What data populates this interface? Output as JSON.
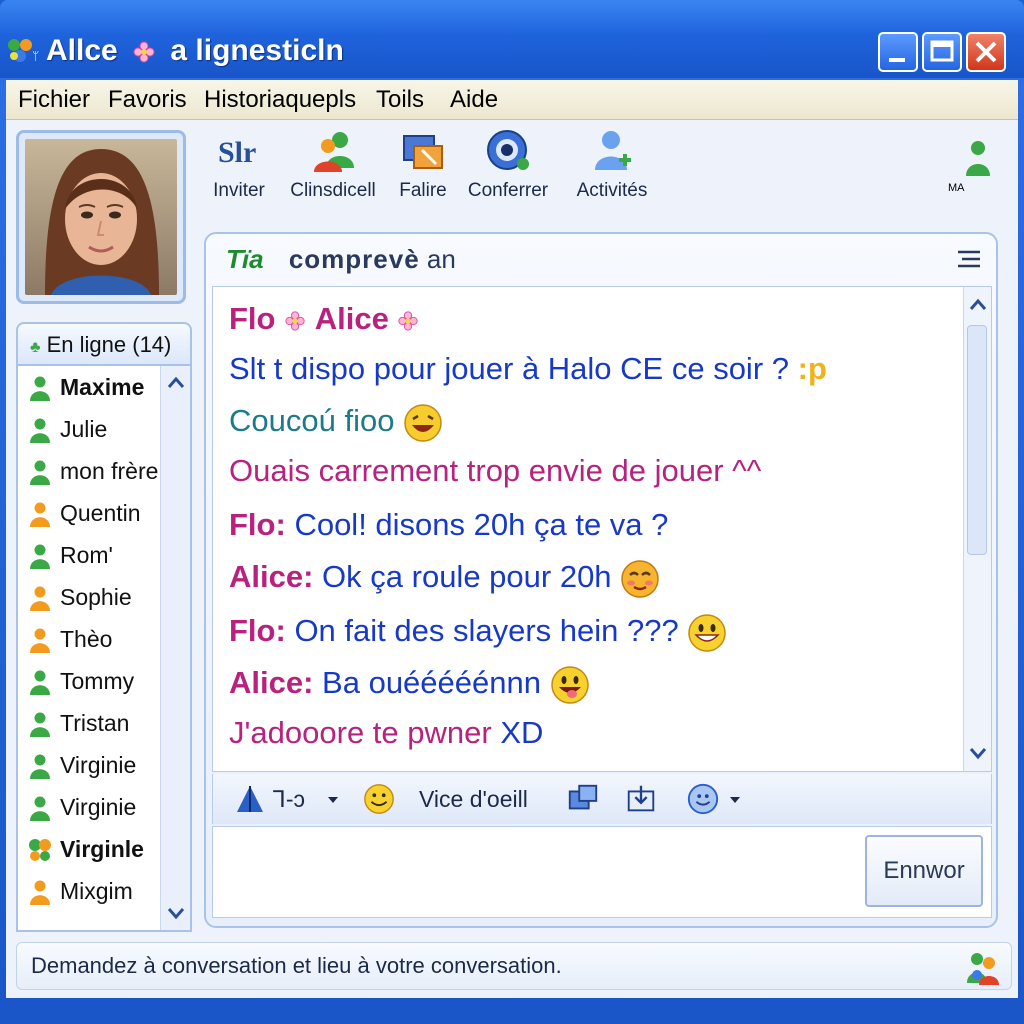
{
  "window": {
    "title": "Allce",
    "title_rest": "a  lignesticln"
  },
  "menu": [
    "Fichier",
    "Favoris",
    "Historiaquepls",
    "Toils",
    "Aide"
  ],
  "toolbar": {
    "items": [
      {
        "label": "Inviter",
        "icon": "invite-text-icon",
        "glyph": "Slr"
      },
      {
        "label": "Clinsdicell",
        "icon": "contacts-icon"
      },
      {
        "label": "Falire",
        "icon": "files-icon"
      },
      {
        "label": "Conferrer",
        "icon": "webcam-icon"
      },
      {
        "label": "Activités",
        "icon": "activities-icon"
      }
    ],
    "corner_label": "MA"
  },
  "contacts": {
    "header": "En ligne (14)",
    "items": [
      {
        "name": "Maxime",
        "status": "online",
        "bold": true
      },
      {
        "name": "Julie",
        "status": "online",
        "bold": false
      },
      {
        "name": "mon frère",
        "status": "online",
        "bold": false
      },
      {
        "name": "Quentin",
        "status": "away",
        "bold": false
      },
      {
        "name": "Rom'",
        "status": "online",
        "bold": false
      },
      {
        "name": "Sophie",
        "status": "away",
        "bold": false
      },
      {
        "name": "Thèo",
        "status": "away",
        "bold": false
      },
      {
        "name": "Tommy",
        "status": "online",
        "bold": false
      },
      {
        "name": "Tristan",
        "status": "online",
        "bold": false
      },
      {
        "name": "Virginie",
        "status": "online",
        "bold": false
      },
      {
        "name": "Virginie",
        "status": "online",
        "bold": false
      },
      {
        "name": "Virginle",
        "status": "butterfly",
        "bold": true
      },
      {
        "name": "Mixgim",
        "status": "away",
        "bold": false
      }
    ]
  },
  "chat": {
    "header_icon": "Tïa",
    "header_title": "comprevè",
    "header_title_rest": "an",
    "messages": [
      {
        "name": "Flo",
        "sep": "",
        "name2": "Alice",
        "text": ""
      },
      {
        "name": "",
        "text": "Slt t dispo pour jouer à Halo CE ce soir ?",
        "suffix": ":p"
      },
      {
        "name": "",
        "text": "Coucoú fioo",
        "emoji": "laughing"
      },
      {
        "name": "",
        "text": "Ouais carrement trop envie de jouer",
        "suffix": "^^"
      },
      {
        "name": "Flo:",
        "text": "Cool! disons 20h ça te va ?"
      },
      {
        "name": "Alice:",
        "text": "Ok ça roule pour 20h",
        "emoji": "blush"
      },
      {
        "name": "Flo:",
        "text": "On fait des slayers hein ???",
        "emoji": "grin"
      },
      {
        "name": "Alice:",
        "text": "Ba ouééééénnn",
        "emoji": "tongue"
      },
      {
        "name": "",
        "text_a": "J'adooore te pwner",
        "text_b": "XD"
      }
    ]
  },
  "format_bar": {
    "font_label": "Ꞁ-ↄ",
    "wink_label": "Vice d'oeill"
  },
  "input": {
    "value": "",
    "send_label": "Ennwor"
  },
  "status": {
    "text": "Demandez à conversation et lieu à votre conversation."
  },
  "colors": {
    "title_blue": "#1f63dc",
    "name_magenta": "#b8227e",
    "text_blue": "#1739c8",
    "teal": "#1d7a8a",
    "online_green": "#3aa844",
    "away_orange": "#f29b1f"
  }
}
